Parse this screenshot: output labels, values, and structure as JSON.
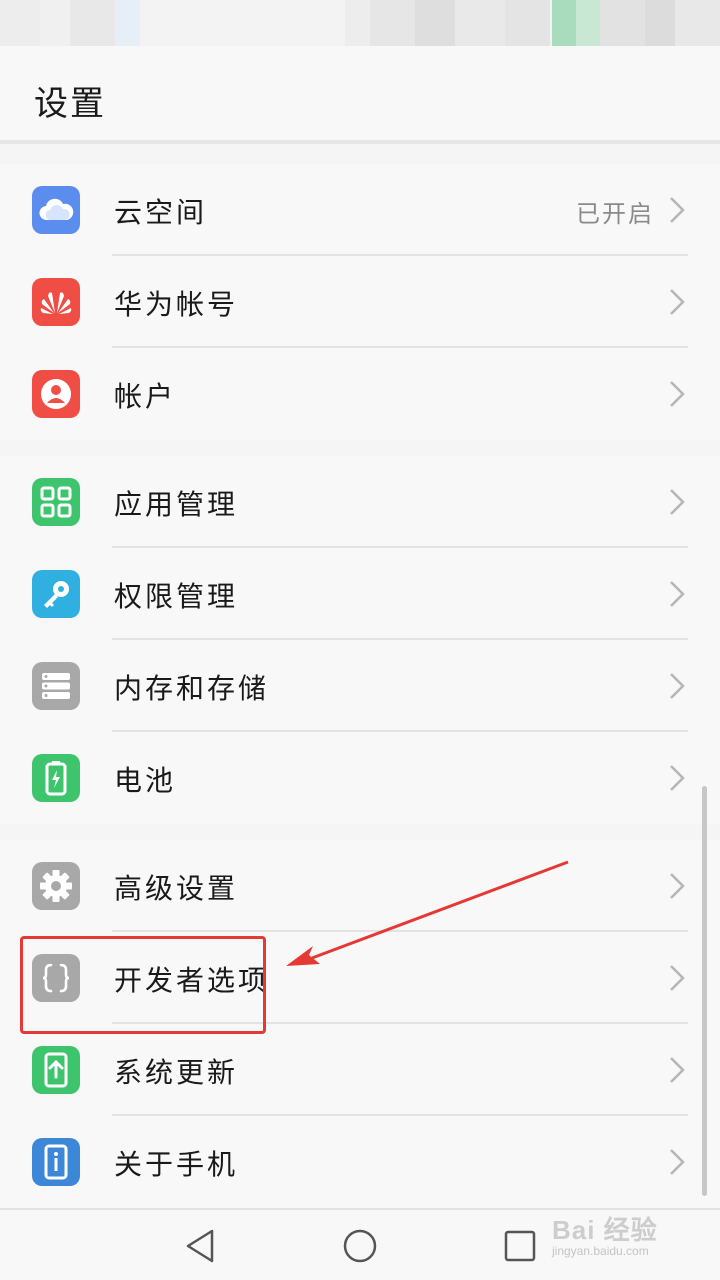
{
  "header": {
    "title": "设置"
  },
  "groups": [
    {
      "items": [
        {
          "label": "云空间",
          "value": "已开启",
          "icon": "cloud-icon",
          "color": "#5b8def"
        },
        {
          "label": "华为帐号",
          "icon": "huawei-logo-icon",
          "color": "#f04e45"
        },
        {
          "label": "帐户",
          "icon": "user-icon",
          "color": "#f04e45"
        }
      ]
    },
    {
      "items": [
        {
          "label": "应用管理",
          "icon": "apps-grid-icon",
          "color": "#3ec46d"
        },
        {
          "label": "权限管理",
          "icon": "key-icon",
          "color": "#2fb0e0"
        },
        {
          "label": "内存和存储",
          "icon": "storage-icon",
          "color": "#a8a8a8"
        },
        {
          "label": "电池",
          "icon": "battery-icon",
          "color": "#3ec46d"
        }
      ]
    },
    {
      "items": [
        {
          "label": "高级设置",
          "icon": "gear-icon",
          "color": "#a8a8a8"
        },
        {
          "label": "开发者选项",
          "icon": "braces-icon",
          "color": "#a8a8a8"
        },
        {
          "label": "系统更新",
          "icon": "system-update-icon",
          "color": "#3ec46d"
        },
        {
          "label": "关于手机",
          "icon": "info-phone-icon",
          "color": "#3d87d9"
        }
      ]
    }
  ],
  "navbar": {
    "buttons": [
      "back-icon",
      "home-icon",
      "recents-icon"
    ]
  },
  "watermark": {
    "brand": "Bai 经验",
    "url": "jingyan.baidu.com"
  },
  "annotation": {
    "color": "#e53935"
  }
}
